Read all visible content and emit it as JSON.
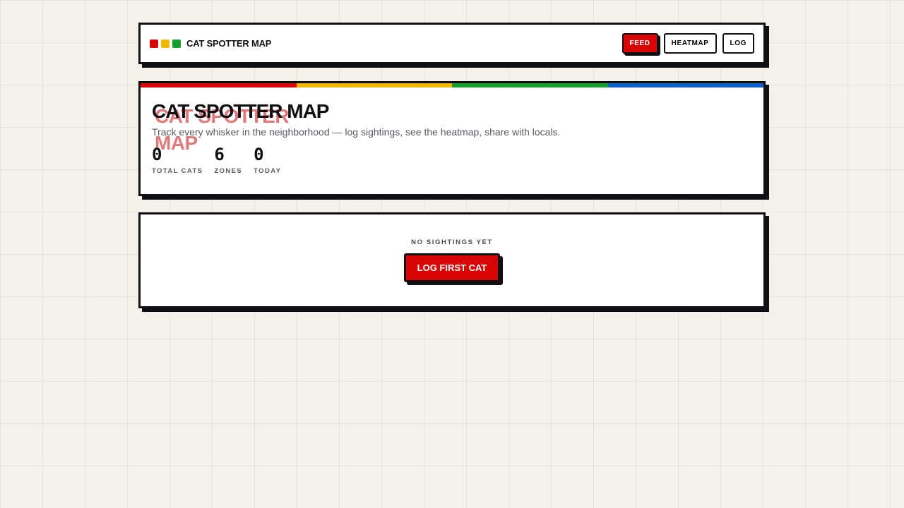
{
  "header": {
    "brand": "CAT SPOTTER MAP",
    "dots": [
      "#d90404",
      "#f2b705",
      "#18a02c"
    ],
    "nav": [
      {
        "label": "FEED",
        "active": true
      },
      {
        "label": "HEATMAP",
        "active": false
      },
      {
        "label": "LOG",
        "active": false
      }
    ]
  },
  "hero": {
    "stripe_colors": [
      "#d90404",
      "#f2b705",
      "#18a02c",
      "#0a63c9"
    ],
    "ghost_title": "CAT SPOTTER MAP",
    "title": "CAT SPOTTER MAP",
    "subtitle": "Track every whisker in the neighborhood — log sightings, see the heatmap, share with locals.",
    "stats": [
      {
        "value": "0",
        "label": "TOTAL CATS"
      },
      {
        "value": "6",
        "label": "ZONES"
      },
      {
        "value": "0",
        "label": "TODAY"
      }
    ]
  },
  "empty_state": {
    "label": "NO SIGHTINGS YET",
    "cta_label": "LOG FIRST CAT"
  },
  "colors": {
    "accent": "#d90404",
    "ink": "#0f0f14",
    "background": "#f4f1eb"
  }
}
